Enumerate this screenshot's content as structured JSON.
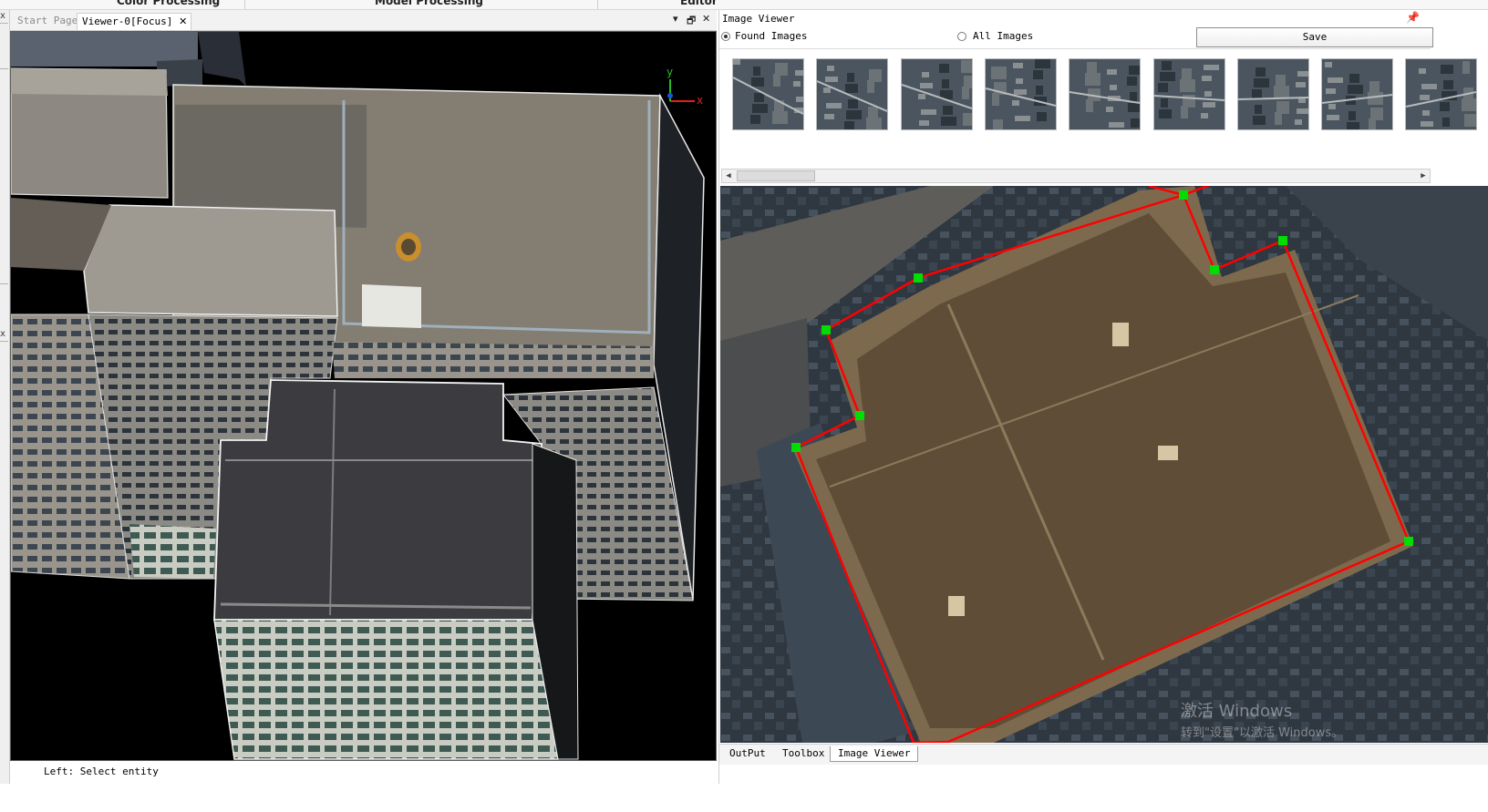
{
  "ribbon": {
    "tabs": [
      "Color Processing",
      "Model Processing",
      "Editor"
    ]
  },
  "document_tabs": {
    "start_page": "Start Page",
    "active": "Viewer-0[Focus]",
    "close_glyph": "✕"
  },
  "window_controls": {
    "dropdown": "▾",
    "restore": "🗗",
    "close": "✕"
  },
  "gutter_glyphs": [
    "x",
    "x"
  ],
  "viewport": {
    "background": "#000000",
    "axis_labels": {
      "y": "y",
      "x": "x"
    },
    "axis_colors": {
      "x": "#e02020",
      "y": "#20c020",
      "z": "#2050e0"
    }
  },
  "status_bar": {
    "text": "Left: Select entity"
  },
  "image_viewer": {
    "title": "Image Viewer",
    "pin_glyph": "📌",
    "radio_found": "Found Images",
    "radio_all": "All Images",
    "selected_mode": "Found Images",
    "save_label": "Save",
    "thumbnail_count": 9,
    "polygon_color": "#ff0000",
    "vertex_color": "#00dd00"
  },
  "bottom_tabs": [
    "OutPut",
    "Toolbox",
    "Image Viewer"
  ],
  "active_bottom_tab": "Image Viewer",
  "watermark": {
    "line1": "激活 Windows",
    "line2": "转到\"设置\"以激活 Windows。"
  }
}
